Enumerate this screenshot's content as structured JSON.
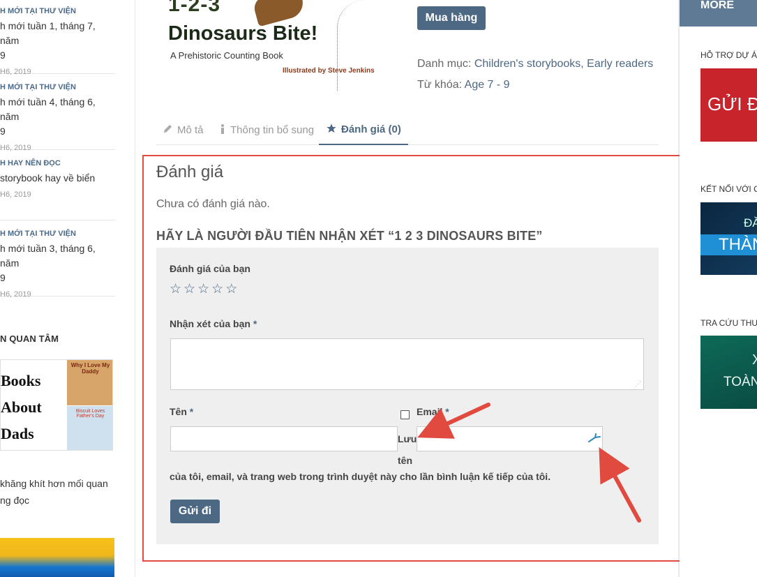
{
  "left_sidebar": {
    "posts": [
      {
        "category": "H MỚI TẠI THƯ VIỆN",
        "title_line1": "h mới tuần 1, tháng 7, năm",
        "title_line2": "9",
        "date": "H6, 2019"
      },
      {
        "category": "H MỚI TẠI THƯ VIỆN",
        "title_line1": "h mới tuần 4, tháng 6, năm",
        "title_line2": "9",
        "date": "H6, 2019"
      },
      {
        "category": "H HAY NÊN ĐỌC",
        "title_line1": "storybook hay về biển",
        "title_line2": "",
        "date": "H6, 2019"
      },
      {
        "category": "H MỚI TẠI THƯ VIỆN",
        "title_line1": "h mới tuần 3, tháng 6, năm",
        "title_line2": "9",
        "date": "H6, 2019"
      }
    ],
    "section_title": "N QUAN TÂM",
    "book_image": {
      "big_text": [
        "Books",
        "About",
        "Dads"
      ],
      "cover1": "Why I Love My Daddy",
      "cover2": "Biscuit Loves Father's Day"
    },
    "text_line1": "khăng khít hơn mối quan",
    "text_line2": "ng đọc"
  },
  "product": {
    "image": {
      "number": "1-2-3",
      "title": "Dinosaurs Bite!",
      "subtitle": "A Prehistoric Counting Book",
      "illustrated": "Illustrated by Steve Jenkins"
    },
    "buy_label": "Mua hàng",
    "category_label": "Danh mục: ",
    "category_value": "Children's storybooks, Early readers",
    "tag_label": "Từ khóa: ",
    "tag_value": "Age 7 - 9"
  },
  "tabs": [
    {
      "label": "Mô tả",
      "icon": "pencil-icon"
    },
    {
      "label": "Thông tin bổ sung",
      "icon": "info-icon"
    },
    {
      "label": "Đánh giá (0)",
      "icon": "star-icon"
    }
  ],
  "reviews": {
    "heading": "Đánh giá",
    "none_text": "Chưa có đánh giá nào.",
    "first_review": "HÃY LÀ NGƯỜI ĐẦU TIÊN NHẬN XÉT “1 2 3 DINOSAURS BITE”",
    "rating_label": "Đánh giá của bạn",
    "stars": [
      "☆",
      "☆",
      "☆",
      "☆",
      "☆"
    ],
    "comment_label": "Nhận xét của bạn",
    "name_label": "Tên",
    "email_label": "Email",
    "required_mark": "*",
    "save_line1": "Lưu",
    "save_line2": "tên",
    "save_rest": "của tôi, email, và trang web trong trình duyệt này cho lần bình luận kế tiếp của tôi.",
    "submit_label": "Gửi đi",
    "comment_value": "",
    "name_value": "",
    "email_value": ""
  },
  "right_sidebar": {
    "more_label": "MORE",
    "support_title": "HỖ TRỢ DỰ ÁN",
    "support_banner": "GỬI ĐỒ",
    "connect_title": "KẾT NỐI VỚI C",
    "connect_banner_top": "ĐĂ",
    "connect_banner_main": "THÀNH",
    "lookup_title": "TRA CỨU THƯ",
    "lookup_banner_top": "X",
    "lookup_banner_main": "TOÀN"
  },
  "colors": {
    "accent": "#4d6882",
    "annotation": "#e04a3f",
    "form_bg": "#efefef"
  }
}
